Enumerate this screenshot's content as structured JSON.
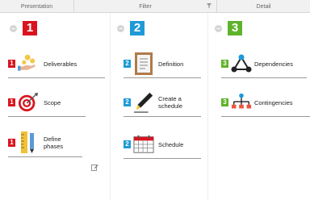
{
  "columns": [
    {
      "header": "Presentation"
    },
    {
      "header": "Filter"
    },
    {
      "header": "Detail"
    }
  ],
  "filter_icon": "filter-icon",
  "groups": [
    {
      "number": "1",
      "color": "#d9141f",
      "items": [
        {
          "badge": "1",
          "label": "Deliverables",
          "icon": "hand-coins-icon"
        },
        {
          "badge": "1",
          "label": "Scope",
          "icon": "target-icon"
        },
        {
          "badge": "1",
          "label_line1": "Define",
          "label_line2": "phases",
          "icon": "ruler-pencil-icon"
        }
      ]
    },
    {
      "number": "2",
      "color": "#1e9ad6",
      "items": [
        {
          "badge": "2",
          "label": "Definition",
          "icon": "document-icon"
        },
        {
          "badge": "2",
          "label_line1": "Create a",
          "label_line2": "schedule",
          "icon": "pen-icon"
        },
        {
          "badge": "2",
          "label": "Schedule",
          "icon": "calendar-icon"
        }
      ]
    },
    {
      "number": "3",
      "color": "#5fb32a",
      "items": [
        {
          "badge": "3",
          "label": "Dependencies",
          "icon": "network-icon"
        },
        {
          "badge": "3",
          "label": "Contingencies",
          "icon": "hierarchy-icon"
        }
      ]
    }
  ],
  "collapse_symbol": "−"
}
